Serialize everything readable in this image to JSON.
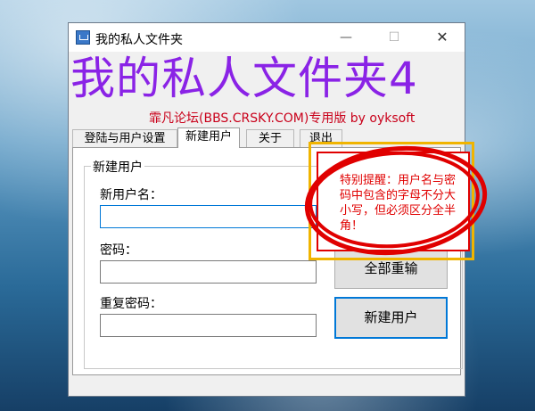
{
  "window": {
    "title": "我的私人文件夹",
    "banner": "我的私人文件夹4",
    "subtitle": "霏凡论坛(BBS.CRSKY.COM)专用版 by oyksoft",
    "controls": {
      "minimize": "—",
      "maximize": "☐",
      "close": "✕"
    }
  },
  "tabs": [
    {
      "label": "登陆与用户设置"
    },
    {
      "label": "新建用户"
    },
    {
      "label": "关于"
    },
    {
      "label": "退出"
    }
  ],
  "form": {
    "group_title": "新建用户",
    "username_label": "新用户名：",
    "username_value": "",
    "password_label": "密码：",
    "password_value": "",
    "confirm_label": "重复密码：",
    "confirm_value": ""
  },
  "buttons": {
    "reset": "全部重输",
    "create": "新建用户"
  },
  "note": {
    "text": "特别提醒：用户名与密码中包含的字母不分大小写，但必须区分全半角！"
  },
  "colors": {
    "banner": "#8a23e6",
    "subtitle": "#c9001a",
    "note": "#e00000",
    "annotation": "#e00000",
    "highlight": "#f0b400"
  }
}
